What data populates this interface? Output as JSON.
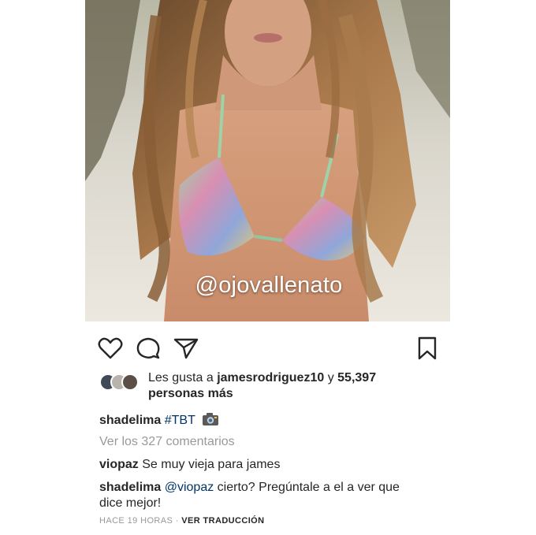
{
  "post": {
    "watermark": "@ojovallenato"
  },
  "actions": {
    "like_icon": "heart-icon",
    "comment_icon": "comment-icon",
    "share_icon": "paper-plane-icon",
    "save_icon": "bookmark-icon"
  },
  "likes": {
    "prefix": "Les gusta a",
    "user": "jamesrodriguez10",
    "connector": "y",
    "count": "55,397",
    "suffix": "personas más"
  },
  "caption": {
    "username": "shadelima",
    "hashtag": "#TBT",
    "emoji_icon": "camera-icon"
  },
  "comments": {
    "view_all": "Ver los 327 comentarios",
    "items": [
      {
        "username": "viopaz",
        "text": "Se muy vieja para james"
      },
      {
        "username": "shadelima",
        "mention": "@viopaz",
        "text": "cierto? Pregúntale a el a ver que",
        "text2": "dice mejor!"
      }
    ]
  },
  "meta": {
    "time": "HACE 19 HORAS",
    "separator": "·",
    "translate": "VER TRADUCCIÓN"
  },
  "colors": {
    "text": "#262626",
    "link": "#003569",
    "muted": "#999999"
  }
}
